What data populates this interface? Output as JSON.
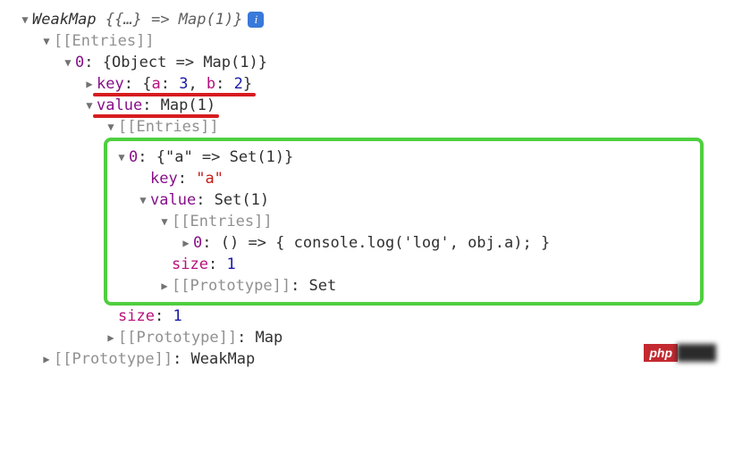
{
  "root": {
    "summary_prefix": "WeakMap",
    "summary_brace": "{{…} => Map(1)}"
  },
  "entries_label": "[[Entries]]",
  "entry0": {
    "index": "0",
    "summary": "{Object => Map(1)}",
    "key_label": "key",
    "key_value_open": "{",
    "key_a_name": "a",
    "key_a_val": "3",
    "key_b_name": "b",
    "key_b_val": "2",
    "key_value_close": "}",
    "value_label": "value",
    "value_summary": "Map(1)"
  },
  "inner": {
    "entries_label": "[[Entries]]",
    "entry0": {
      "index": "0",
      "summary": "{\"a\" => Set(1)}",
      "key_label": "key",
      "key_value": "\"a\"",
      "value_label": "value",
      "value_summary": "Set(1)",
      "entries_label": "[[Entries]]",
      "inner_entry": {
        "index": "0",
        "value": "() => { console.log('log', obj.a); }"
      },
      "size_label": "size",
      "size_value": "1",
      "proto_label": "[[Prototype]]",
      "proto_value": "Set"
    },
    "size_label": "size",
    "size_value": "1",
    "proto_label": "[[Prototype]]",
    "proto_value": "Map"
  },
  "outer_proto_label": "[[Prototype]]",
  "outer_proto_value": "WeakMap",
  "watermark": "php"
}
